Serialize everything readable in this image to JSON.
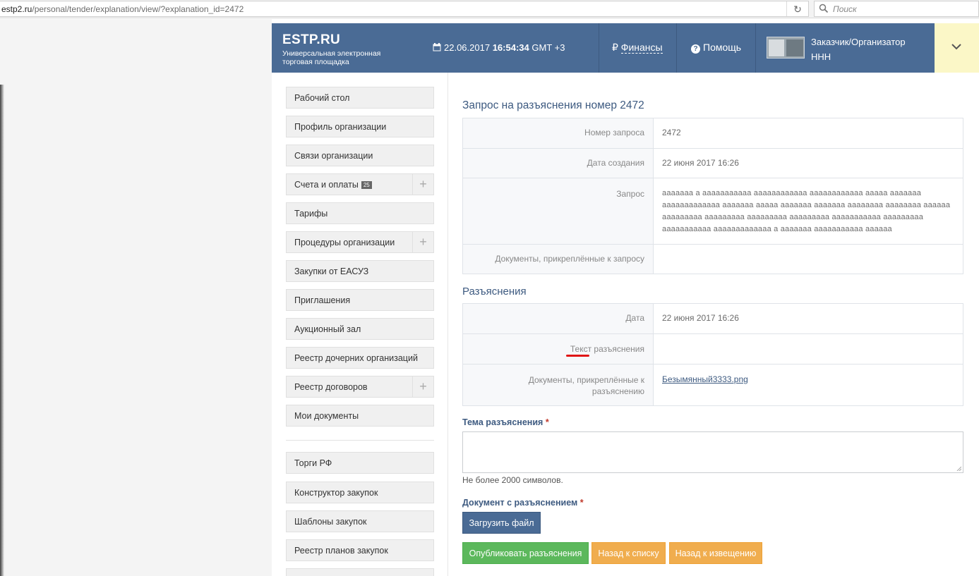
{
  "browser": {
    "url_domain": "estp2.ru",
    "url_path": "/personal/tender/explanation/view/?explanation_id=2472",
    "search_placeholder": "Поиск"
  },
  "header": {
    "logo": "ESTP.RU",
    "logo_subtitle": "Универсальная электронная торговая площадка",
    "date": "22.06.2017",
    "time": "16:54:34",
    "timezone": "GMT +3",
    "finance_label": "Финансы",
    "help_label": "Помощь",
    "role": "Заказчик/Организатор",
    "org": "ННН"
  },
  "sidebar": {
    "items": [
      {
        "label": "Рабочий стол"
      },
      {
        "label": "Профиль организации"
      },
      {
        "label": "Связи организации"
      },
      {
        "label": "Счета и оплаты",
        "badge": "25",
        "expandable": true
      },
      {
        "label": "Тарифы"
      },
      {
        "label": "Процедуры организации",
        "expandable": true
      },
      {
        "label": "Закупки от ЕАСУЗ"
      },
      {
        "label": "Приглашения"
      },
      {
        "label": "Аукционный зал"
      },
      {
        "label": "Реестр дочерних организаций"
      },
      {
        "label": "Реестр договоров",
        "expandable": true
      },
      {
        "label": "Мои документы"
      }
    ],
    "items2": [
      {
        "label": "Торги РФ"
      },
      {
        "label": "Конструктор закупок"
      },
      {
        "label": "Шаблоны закупок"
      },
      {
        "label": "Реестр планов закупок"
      }
    ]
  },
  "request": {
    "title": "Запрос на разъяснения номер 2472",
    "rows": [
      {
        "label": "Номер запроса",
        "value": "2472"
      },
      {
        "label": "Дата создания",
        "value": "22 июня 2017 16:26"
      },
      {
        "label": "Запрос",
        "value": "ааааааа а ааааааааааа аааааааааааа аааааааааааа ааааа ааааааа ааааааааааааа ааааааа ааааа ааааааа ааааааа аааааааа аааааааа аааааа ааааааааа ааааааааа ааааааааа ааааааааа ааааааааааа ааааааааа ааааааааааа ааааааааааааа а ааааааа ааааааааааа аааааа"
      },
      {
        "label": "Документы, прикреплённые к запросу",
        "value": ""
      }
    ]
  },
  "explanations": {
    "title": "Разъяснения",
    "rows": [
      {
        "label": "Дата",
        "value": "22 июня 2017 16:26"
      },
      {
        "label_a": "Текст",
        "label_b": " разъяснения",
        "value": ""
      },
      {
        "label_line1": "Документы, прикреплённые к",
        "label_line2": "разъяснению",
        "value": "Безымянный3333.png"
      }
    ]
  },
  "form": {
    "topic_label": "Тема разъяснения",
    "required_mark": "*",
    "topic_value": "",
    "hint": "Не более 2000 символов.",
    "doc_label": "Документ с разъяснением",
    "upload_button": "Загрузить файл"
  },
  "actions": {
    "publish": "Опубликовать разъяснения",
    "back_list": "Назад к списку",
    "back_notice": "Назад к извещению"
  },
  "colors": {
    "header_bg": "#4a6b95",
    "dropdown_bg": "#fbf7c7",
    "publish_btn": "#5cb85c",
    "back_btn": "#f0ad4e",
    "annotation_underline": "#e01515"
  }
}
